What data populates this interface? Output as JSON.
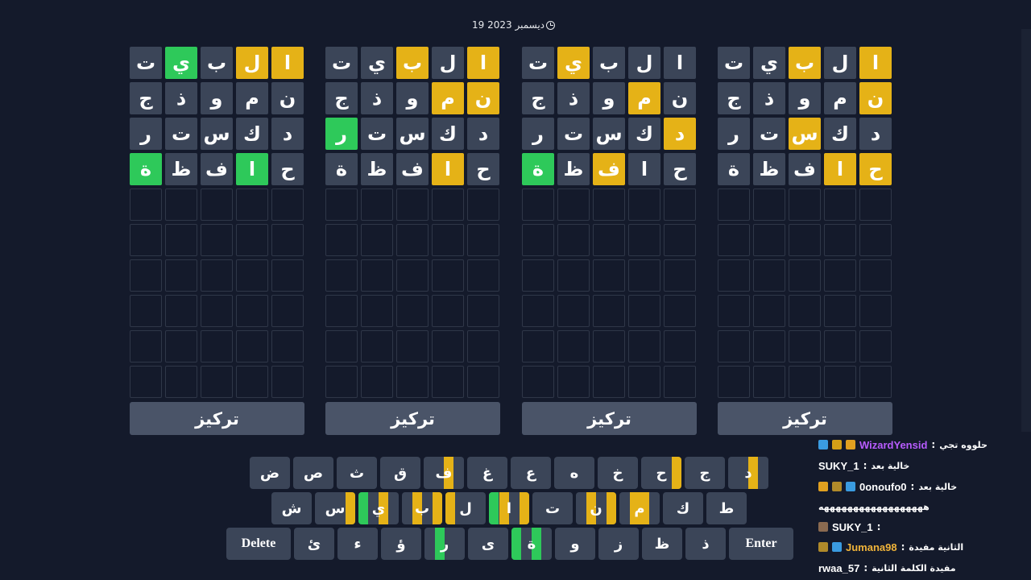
{
  "date": "19 ديسمبر 2023",
  "boards": [
    {
      "rows": [
        [
          {
            "l": "ت",
            "s": "n"
          },
          {
            "l": "ي",
            "s": "g"
          },
          {
            "l": "ب",
            "s": "n"
          },
          {
            "l": "ل",
            "s": "y"
          },
          {
            "l": "ا",
            "s": "y"
          }
        ],
        [
          {
            "l": "ج",
            "s": "n"
          },
          {
            "l": "ذ",
            "s": "n"
          },
          {
            "l": "و",
            "s": "n"
          },
          {
            "l": "م",
            "s": "n"
          },
          {
            "l": "ن",
            "s": "n"
          }
        ],
        [
          {
            "l": "ر",
            "s": "n"
          },
          {
            "l": "ت",
            "s": "n"
          },
          {
            "l": "س",
            "s": "n"
          },
          {
            "l": "ك",
            "s": "n"
          },
          {
            "l": "د",
            "s": "n"
          }
        ],
        [
          {
            "l": "ة",
            "s": "g"
          },
          {
            "l": "ظ",
            "s": "n"
          },
          {
            "l": "ف",
            "s": "n"
          },
          {
            "l": "ا",
            "s": "g"
          },
          {
            "l": "ح",
            "s": "n"
          }
        ]
      ],
      "focus_label": "تركيز"
    },
    {
      "rows": [
        [
          {
            "l": "ت",
            "s": "n"
          },
          {
            "l": "ي",
            "s": "n"
          },
          {
            "l": "ب",
            "s": "y"
          },
          {
            "l": "ل",
            "s": "n"
          },
          {
            "l": "ا",
            "s": "y"
          }
        ],
        [
          {
            "l": "ج",
            "s": "n"
          },
          {
            "l": "ذ",
            "s": "n"
          },
          {
            "l": "و",
            "s": "n"
          },
          {
            "l": "م",
            "s": "y"
          },
          {
            "l": "ن",
            "s": "y"
          }
        ],
        [
          {
            "l": "ر",
            "s": "g"
          },
          {
            "l": "ت",
            "s": "n"
          },
          {
            "l": "س",
            "s": "n"
          },
          {
            "l": "ك",
            "s": "n"
          },
          {
            "l": "د",
            "s": "n"
          }
        ],
        [
          {
            "l": "ة",
            "s": "n"
          },
          {
            "l": "ظ",
            "s": "n"
          },
          {
            "l": "ف",
            "s": "n"
          },
          {
            "l": "ا",
            "s": "y"
          },
          {
            "l": "ح",
            "s": "n"
          }
        ]
      ],
      "focus_label": "تركيز"
    },
    {
      "rows": [
        [
          {
            "l": "ت",
            "s": "n"
          },
          {
            "l": "ي",
            "s": "y"
          },
          {
            "l": "ب",
            "s": "n"
          },
          {
            "l": "ل",
            "s": "n"
          },
          {
            "l": "ا",
            "s": "n"
          }
        ],
        [
          {
            "l": "ج",
            "s": "n"
          },
          {
            "l": "ذ",
            "s": "n"
          },
          {
            "l": "و",
            "s": "n"
          },
          {
            "l": "م",
            "s": "y"
          },
          {
            "l": "ن",
            "s": "n"
          }
        ],
        [
          {
            "l": "ر",
            "s": "n"
          },
          {
            "l": "ت",
            "s": "n"
          },
          {
            "l": "س",
            "s": "n"
          },
          {
            "l": "ك",
            "s": "n"
          },
          {
            "l": "د",
            "s": "y"
          }
        ],
        [
          {
            "l": "ة",
            "s": "g"
          },
          {
            "l": "ظ",
            "s": "n"
          },
          {
            "l": "ف",
            "s": "y"
          },
          {
            "l": "ا",
            "s": "n"
          },
          {
            "l": "ح",
            "s": "n"
          }
        ]
      ],
      "focus_label": "تركيز"
    },
    {
      "rows": [
        [
          {
            "l": "ت",
            "s": "n"
          },
          {
            "l": "ي",
            "s": "n"
          },
          {
            "l": "ب",
            "s": "y"
          },
          {
            "l": "ل",
            "s": "n"
          },
          {
            "l": "ا",
            "s": "y"
          }
        ],
        [
          {
            "l": "ج",
            "s": "n"
          },
          {
            "l": "ذ",
            "s": "n"
          },
          {
            "l": "و",
            "s": "n"
          },
          {
            "l": "م",
            "s": "n"
          },
          {
            "l": "ن",
            "s": "y"
          }
        ],
        [
          {
            "l": "ر",
            "s": "n"
          },
          {
            "l": "ت",
            "s": "n"
          },
          {
            "l": "س",
            "s": "y"
          },
          {
            "l": "ك",
            "s": "n"
          },
          {
            "l": "د",
            "s": "n"
          }
        ],
        [
          {
            "l": "ة",
            "s": "n"
          },
          {
            "l": "ظ",
            "s": "n"
          },
          {
            "l": "ف",
            "s": "n"
          },
          {
            "l": "ا",
            "s": "y"
          },
          {
            "l": "ح",
            "s": "y"
          }
        ]
      ],
      "focus_label": "تركيز"
    }
  ],
  "keyboard": {
    "row1": [
      {
        "l": "ض",
        "m": [
          "n",
          "n",
          "n",
          "n"
        ]
      },
      {
        "l": "ص",
        "m": [
          "n",
          "n",
          "n",
          "n"
        ]
      },
      {
        "l": "ث",
        "m": [
          "n",
          "n",
          "n",
          "n"
        ]
      },
      {
        "l": "ق",
        "m": [
          "n",
          "n",
          "n",
          "n"
        ]
      },
      {
        "l": "ف",
        "m": [
          "n",
          "n",
          "y",
          "n"
        ]
      },
      {
        "l": "غ",
        "m": [
          "n",
          "n",
          "n",
          "n"
        ]
      },
      {
        "l": "ع",
        "m": [
          "n",
          "n",
          "n",
          "n"
        ]
      },
      {
        "l": "ه",
        "m": [
          "n",
          "n",
          "n",
          "n"
        ]
      },
      {
        "l": "خ",
        "m": [
          "n",
          "n",
          "n",
          "n"
        ]
      },
      {
        "l": "ح",
        "m": [
          "n",
          "n",
          "n",
          "y"
        ]
      },
      {
        "l": "ج",
        "m": [
          "n",
          "n",
          "n",
          "n"
        ]
      },
      {
        "l": "د",
        "m": [
          "n",
          "n",
          "y",
          "n"
        ]
      }
    ],
    "row2": [
      {
        "l": "ش",
        "m": [
          "n",
          "n",
          "n",
          "n"
        ]
      },
      {
        "l": "س",
        "m": [
          "n",
          "n",
          "n",
          "y"
        ]
      },
      {
        "l": "ي",
        "m": [
          "g",
          "n",
          "y",
          "n"
        ]
      },
      {
        "l": "ب",
        "m": [
          "n",
          "y",
          "n",
          "y"
        ]
      },
      {
        "l": "ل",
        "m": [
          "y",
          "n",
          "n",
          "n"
        ]
      },
      {
        "l": "ا",
        "m": [
          "g",
          "y",
          "n",
          "y"
        ]
      },
      {
        "l": "ت",
        "m": [
          "n",
          "n",
          "n",
          "n"
        ]
      },
      {
        "l": "ن",
        "m": [
          "n",
          "y",
          "n",
          "y"
        ]
      },
      {
        "l": "م",
        "m": [
          "n",
          "y",
          "y",
          "n"
        ]
      },
      {
        "l": "ك",
        "m": [
          "n",
          "n",
          "n",
          "n"
        ]
      },
      {
        "l": "ط",
        "m": [
          "n",
          "n",
          "n",
          "n"
        ]
      }
    ],
    "row3": [
      {
        "l": "Delete",
        "wide": true
      },
      {
        "l": "ئ",
        "m": [
          "n",
          "n",
          "n",
          "n"
        ]
      },
      {
        "l": "ء",
        "m": [
          "n",
          "n",
          "n",
          "n"
        ]
      },
      {
        "l": "ؤ",
        "m": [
          "n",
          "n",
          "n",
          "n"
        ]
      },
      {
        "l": "ر",
        "m": [
          "n",
          "g",
          "n",
          "n"
        ]
      },
      {
        "l": "ى",
        "m": [
          "n",
          "n",
          "n",
          "n"
        ]
      },
      {
        "l": "ة",
        "m": [
          "g",
          "n",
          "g",
          "n"
        ]
      },
      {
        "l": "و",
        "m": [
          "n",
          "n",
          "n",
          "n"
        ]
      },
      {
        "l": "ز",
        "m": [
          "n",
          "n",
          "n",
          "n"
        ]
      },
      {
        "l": "ظ",
        "m": [
          "n",
          "n",
          "n",
          "n"
        ]
      },
      {
        "l": "ذ",
        "m": [
          "n",
          "n",
          "n",
          "n"
        ]
      },
      {
        "l": "Enter",
        "wide": true
      }
    ]
  },
  "chat": [
    {
      "user": "WizardYensid",
      "text": "حلووه تجي",
      "user_color": "#b85cff",
      "badges": [
        "#e0a020",
        "#d4a017",
        "#3a9be0"
      ]
    },
    {
      "user": "SUKY_1",
      "text": "خالية بعد",
      "user_color": "#ffffff",
      "badges": []
    },
    {
      "user": "0onoufo0",
      "text": "خالية بعد",
      "user_color": "#ffffff",
      "badges": [
        "#3a9be0",
        "#b08a2a",
        "#e0a020"
      ]
    },
    {
      "user": "",
      "text": "ههههههههههههههههههه",
      "user_color": "#ffffff",
      "badges": []
    },
    {
      "user": "SUKY_1",
      "text": "",
      "user_color": "#ffffff",
      "badges": [
        "#8a6a50"
      ]
    },
    {
      "user": "Jumana98",
      "text": "الثانية مفيدة",
      "user_color": "#f0b43a",
      "badges": [
        "#3a9be0",
        "#b08a2a"
      ]
    },
    {
      "user": "rwaa_57",
      "text": "مفيدة الكلمة الثانية",
      "user_color": "#ffffff",
      "badges": []
    }
  ],
  "colors": {
    "absent": "#3b4558",
    "present": "#e5b217",
    "correct": "#2ec95a",
    "background": "#141a2b"
  }
}
